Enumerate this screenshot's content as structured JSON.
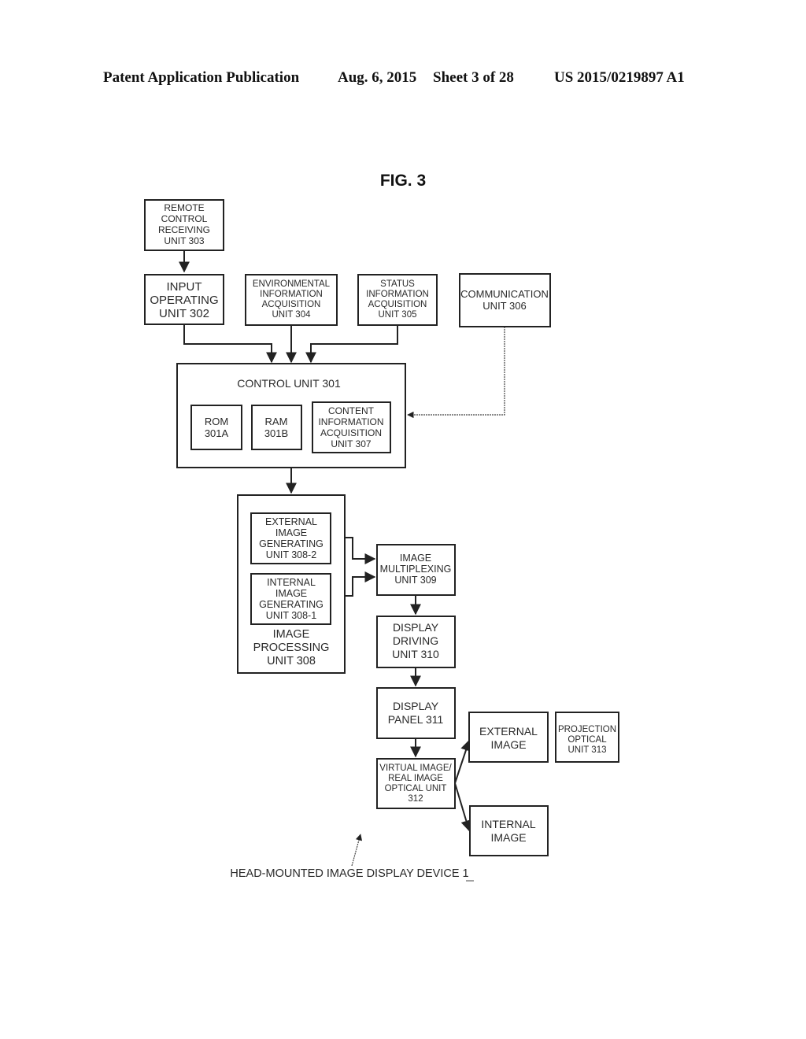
{
  "header": {
    "publication": "Patent Application Publication",
    "date": "Aug. 6, 2015",
    "sheet": "Sheet 3 of 28",
    "number": "US 2015/0219897 A1"
  },
  "figure": {
    "title": "FIG. 3",
    "caption": "HEAD-MOUNTED IMAGE DISPLAY DEVICE 1"
  },
  "boxes": {
    "remote_control": [
      "REMOTE",
      "CONTROL",
      "RECEIVING",
      "UNIT 303"
    ],
    "input_operating": [
      "INPUT",
      "OPERATING",
      "UNIT 302"
    ],
    "environmental": [
      "ENVIRONMENTAL",
      "INFORMATION",
      "ACQUISITION",
      "UNIT 304"
    ],
    "status": [
      "STATUS",
      "INFORMATION",
      "ACQUISITION",
      "UNIT 305"
    ],
    "communication": [
      "COMMUNICATION",
      "UNIT 306"
    ],
    "control_unit": [
      "CONTROL UNIT 301"
    ],
    "rom": [
      "ROM",
      "301A"
    ],
    "ram": [
      "RAM",
      "301B"
    ],
    "content_info": [
      "CONTENT",
      "INFORMATION",
      "ACQUISITION",
      "UNIT 307"
    ],
    "image_processing": [
      "IMAGE",
      "PROCESSING",
      "UNIT 308"
    ],
    "external_gen": [
      "EXTERNAL",
      "IMAGE",
      "GENERATING",
      "UNIT 308-2"
    ],
    "internal_gen": [
      "INTERNAL",
      "IMAGE",
      "GENERATING",
      "UNIT 308-1"
    ],
    "multiplexing": [
      "IMAGE",
      "MULTIPLEXING",
      "UNIT 309"
    ],
    "display_driving": [
      "DISPLAY",
      "DRIVING",
      "UNIT 310"
    ],
    "display_panel": [
      "DISPLAY",
      "PANEL 311"
    ],
    "optical_312": [
      "VIRTUAL IMAGE/",
      "REAL IMAGE",
      "OPTICAL UNIT",
      "312"
    ],
    "external_image": [
      "EXTERNAL",
      "IMAGE"
    ],
    "internal_image": [
      "INTERNAL",
      "IMAGE"
    ],
    "projection": [
      "PROJECTION",
      "OPTICAL",
      "UNIT 313"
    ]
  }
}
